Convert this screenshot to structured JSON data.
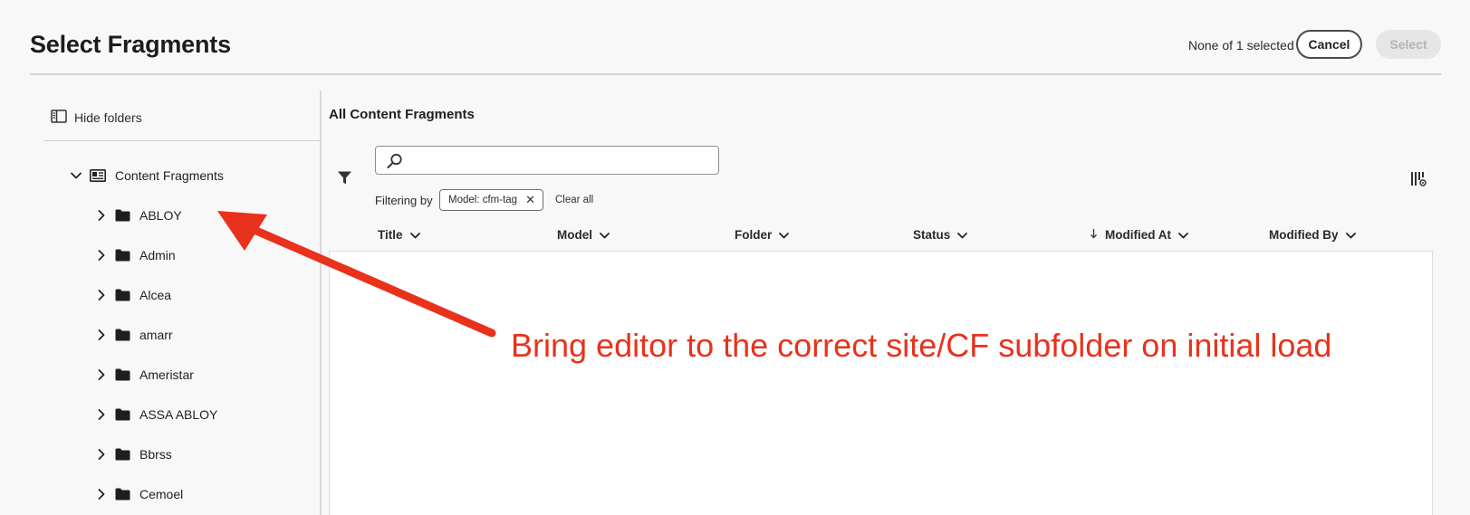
{
  "dialog": {
    "title": "Select Fragments",
    "selection_count": "None of 1 selected",
    "cancel_label": "Cancel",
    "select_label": "Select"
  },
  "sidebar": {
    "hide_folders_label": "Hide folders",
    "root": {
      "label": "Content Fragments",
      "icon": "content-fragments-icon",
      "expanded": true
    },
    "folders": [
      {
        "label": "ABLOY",
        "icon": "folder-icon"
      },
      {
        "label": "Admin",
        "icon": "folder-icon"
      },
      {
        "label": "Alcea",
        "icon": "folder-icon"
      },
      {
        "label": "amarr",
        "icon": "folder-icon"
      },
      {
        "label": "Ameristar",
        "icon": "folder-icon"
      },
      {
        "label": "ASSA ABLOY",
        "icon": "folder-icon"
      },
      {
        "label": "Bbrss",
        "icon": "folder-icon"
      },
      {
        "label": "Cemoel",
        "icon": "folder-icon"
      }
    ]
  },
  "main": {
    "section_title": "All Content Fragments",
    "search": {
      "value": "",
      "placeholder": ""
    },
    "filtering_by_label": "Filtering by",
    "filter_chip": "Model: cfm-tag",
    "clear_all_label": "Clear all",
    "columns": [
      {
        "label": "Title"
      },
      {
        "label": "Model"
      },
      {
        "label": "Folder"
      },
      {
        "label": "Status"
      },
      {
        "label": "Modified At",
        "sorted": "descending"
      },
      {
        "label": "Modified By"
      }
    ]
  },
  "annotation": {
    "text": "Bring editor to the correct site/CF subfolder on initial load",
    "color": "#e8321c"
  }
}
